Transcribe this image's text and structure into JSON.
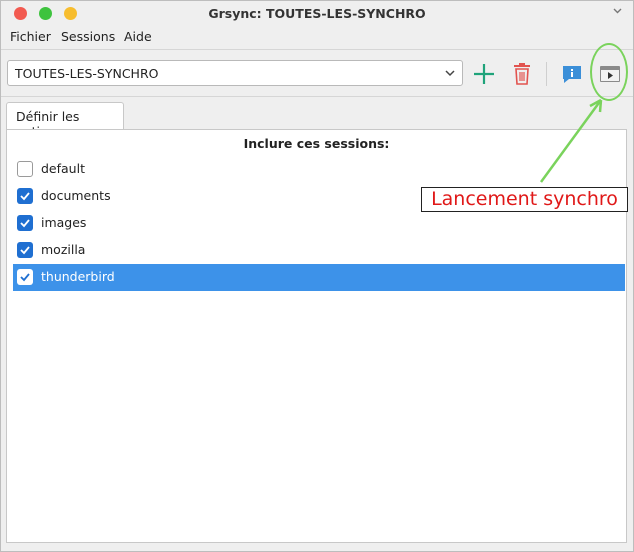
{
  "window": {
    "title": "Grsync: TOUTES-LES-SYNCHRO"
  },
  "menu": {
    "items": [
      "Fichier",
      "Sessions",
      "Aide"
    ]
  },
  "toolbar": {
    "session_value": "TOUTES-LES-SYNCHRO"
  },
  "tabs": {
    "active": "Définir les options"
  },
  "panel": {
    "title": "Inclure ces sessions:",
    "sessions": [
      {
        "label": "default",
        "checked": false
      },
      {
        "label": "documents",
        "checked": true
      },
      {
        "label": "images",
        "checked": true
      },
      {
        "label": "mozilla",
        "checked": true
      },
      {
        "label": "thunderbird",
        "checked": true,
        "selected": true
      }
    ]
  },
  "annotation": {
    "text": "Lancement synchro",
    "color": "#e01818",
    "arrow_color": "#7ad35c"
  },
  "colors": {
    "selection": "#3d92e9",
    "checkbox": "#1f6fd1",
    "add": "#1fa37a",
    "delete": "#e2534f",
    "info": "#3b8fd8"
  }
}
